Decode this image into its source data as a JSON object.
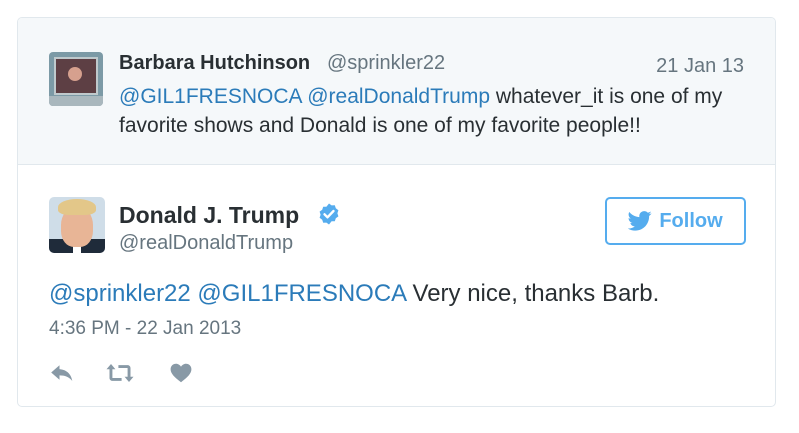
{
  "parent_tweet": {
    "name": "Barbara Hutchinson",
    "handle": "@sprinkler22",
    "date": "21 Jan 13",
    "mention_1": "@GIL1FRESNOCA",
    "mention_2": "@realDonaldTrump",
    "text": "whatever_it is one of my favorite shows and Donald is one of my favorite people!!",
    "avatar_icon": "framed-photo-avatar"
  },
  "main_tweet": {
    "name": "Donald J. Trump",
    "handle": "@realDonaldTrump",
    "verified_icon": "verified-badge-icon",
    "follow_label": "Follow",
    "mention_1": "@sprinkler22",
    "mention_2": "@GIL1FRESNOCA",
    "text": "Very nice, thanks Barb.",
    "timestamp": "4:36 PM - 22 Jan 2013",
    "avatar_icon": "portrait-avatar"
  },
  "actions": [
    {
      "icon": "reply-icon"
    },
    {
      "icon": "retweet-icon"
    },
    {
      "icon": "like-heart-icon"
    }
  ],
  "colors": {
    "link": "#2b7bb9",
    "twitter_blue": "#55acee",
    "muted": "#66757f",
    "text": "#292f33",
    "icon_gray": "#8899a6",
    "parent_bg": "#f5f8fa",
    "border": "#e1e8ed"
  }
}
